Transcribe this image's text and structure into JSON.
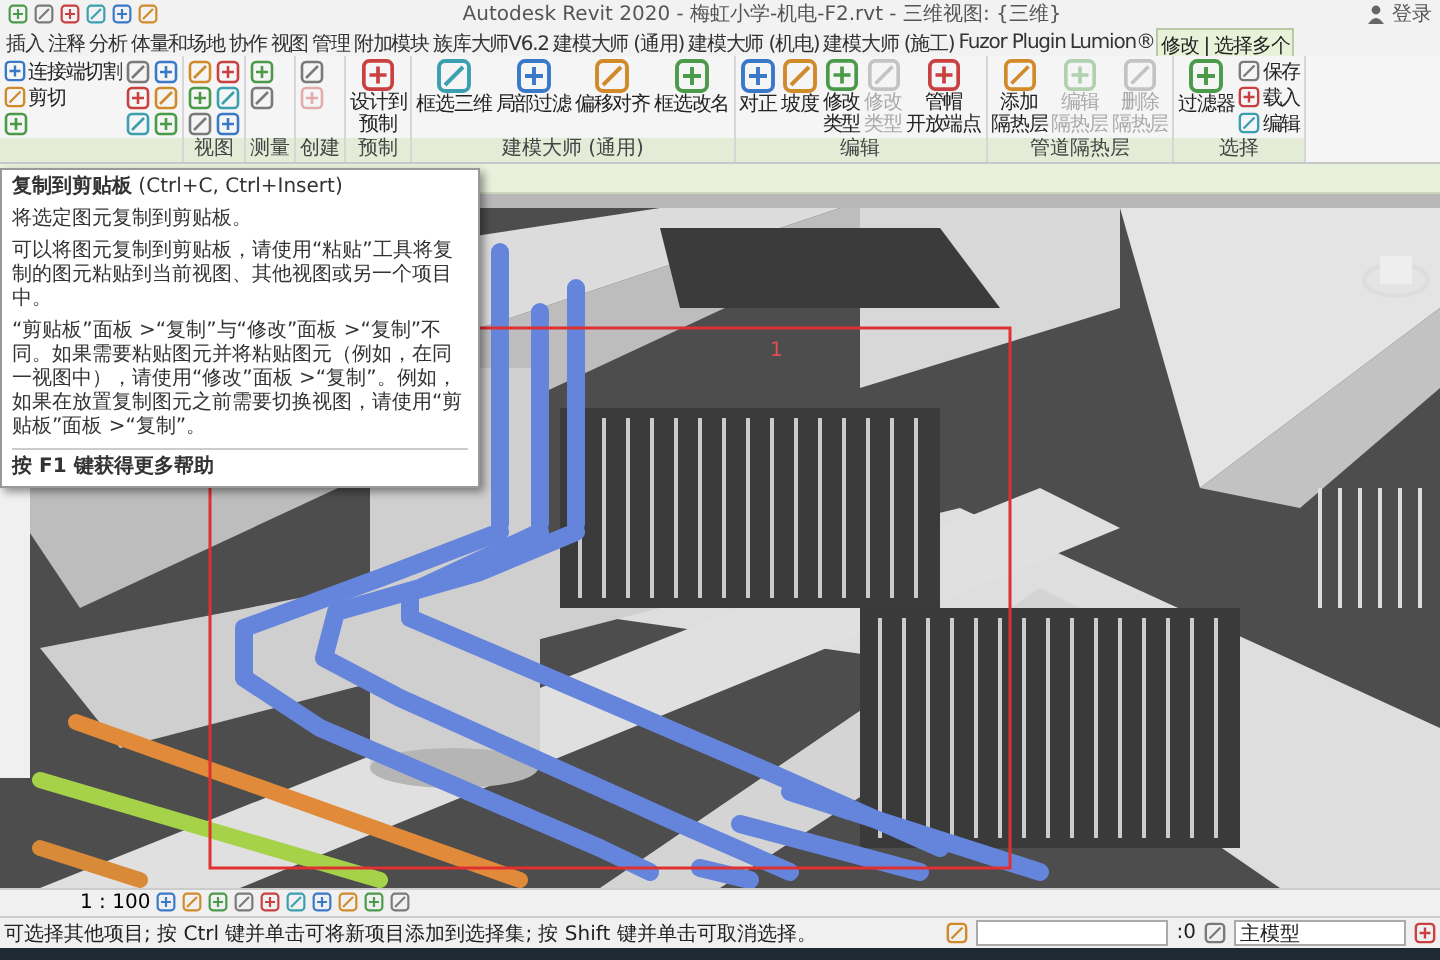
{
  "title_bar": {
    "title": "Autodesk Revit 2020 - 梅虹小学-机电-F2.rvt - 三维视图: {三维}",
    "user": "登录"
  },
  "tabs": [
    {
      "label": "插入",
      "selected": false
    },
    {
      "label": "注释",
      "selected": false
    },
    {
      "label": "分析",
      "selected": false
    },
    {
      "label": "体量和场地",
      "selected": false
    },
    {
      "label": "协作",
      "selected": false
    },
    {
      "label": "视图",
      "selected": false
    },
    {
      "label": "管理",
      "selected": false
    },
    {
      "label": "附加模块",
      "selected": false
    },
    {
      "label": "族库大师V6.2",
      "selected": false
    },
    {
      "label": "建模大师 (通用)",
      "selected": false
    },
    {
      "label": "建模大师 (机电)",
      "selected": false
    },
    {
      "label": "建模大师 (施工)",
      "selected": false
    },
    {
      "label": "Fuzor Plugin",
      "selected": false
    },
    {
      "label": "Lumion®",
      "selected": false
    },
    {
      "label": "修改 | 选择多个",
      "selected": true
    }
  ],
  "ribbon": {
    "panels": [
      {
        "buttons": [
          {
            "kind": "small",
            "label": "连接端切割",
            "disabled": false
          },
          {
            "kind": "small",
            "label": "剪切",
            "disabled": false
          },
          {
            "kind": "icon",
            "disabled": false
          },
          {
            "kind": "icon",
            "disabled": false
          },
          {
            "kind": "icon",
            "disabled": false
          },
          {
            "kind": "icon",
            "disabled": false
          },
          {
            "kind": "icon",
            "disabled": false
          },
          {
            "kind": "icon",
            "disabled": false
          },
          {
            "kind": "icon",
            "disabled": false
          }
        ]
      },
      {
        "label": "视图",
        "buttons": [
          {
            "kind": "icon",
            "disabled": false
          },
          {
            "kind": "icon",
            "disabled": false
          },
          {
            "kind": "icon",
            "disabled": false
          },
          {
            "kind": "icon",
            "disabled": false
          },
          {
            "kind": "icon",
            "disabled": false
          },
          {
            "kind": "icon",
            "disabled": false
          }
        ]
      },
      {
        "label": "测量",
        "buttons": [
          {
            "kind": "icon",
            "disabled": false
          },
          {
            "kind": "icon",
            "disabled": false
          }
        ]
      },
      {
        "label": "创建",
        "buttons": [
          {
            "kind": "icon",
            "disabled": false
          },
          {
            "kind": "icon",
            "disabled": true
          }
        ]
      },
      {
        "label": "预制",
        "buttons": [
          {
            "kind": "large",
            "label": [
              "设计到",
              "预制"
            ],
            "disabled": false
          }
        ]
      },
      {
        "label": "建模大师 (通用)",
        "buttons": [
          {
            "kind": "large",
            "label": "框选三维",
            "disabled": false
          },
          {
            "kind": "large",
            "label": "局部过滤",
            "disabled": false
          },
          {
            "kind": "large",
            "label": "偏移对齐",
            "disabled": false
          },
          {
            "kind": "large",
            "label": "框选改名",
            "disabled": false
          }
        ]
      },
      {
        "label": "编辑",
        "buttons": [
          {
            "kind": "large",
            "label": "对正",
            "disabled": false
          },
          {
            "kind": "large",
            "label": "坡度",
            "disabled": false
          },
          {
            "kind": "large",
            "label": [
              "修改",
              "类型"
            ],
            "disabled": false
          },
          {
            "kind": "large",
            "label": [
              "修改",
              "类型"
            ],
            "disabled": true
          },
          {
            "kind": "large",
            "label": [
              "管帽",
              "开放端点"
            ],
            "disabled": false
          }
        ]
      },
      {
        "label": "管道隔热层",
        "buttons": [
          {
            "kind": "large",
            "label": [
              "添加",
              "隔热层"
            ],
            "disabled": false
          },
          {
            "kind": "large",
            "label": [
              "编辑",
              "隔热层"
            ],
            "disabled": true
          },
          {
            "kind": "large",
            "label": [
              "删除",
              "隔热层"
            ],
            "disabled": true
          }
        ]
      },
      {
        "label": "选择",
        "buttons": [
          {
            "kind": "large",
            "label": "过滤器",
            "disabled": false
          },
          {
            "kind": "small",
            "label": "保存",
            "disabled": false
          },
          {
            "kind": "small",
            "label": "载入",
            "disabled": false
          },
          {
            "kind": "small",
            "label": "编辑",
            "disabled": false
          }
        ]
      }
    ]
  },
  "tooltip": {
    "title": "**复制到剪贴板** (Ctrl+C, Ctrl+Insert)",
    "description": "将选定图元复制到剪贴板。",
    "details": [
      "可以将图元复制到剪贴板，请使用“粘贴”工具将复制的图元粘贴到当前视图、其他视图或另一个项目中。",
      "“剪贴板”面板 >“复制”与“修改”面板 >“复制”不同。如果需要粘贴图元并将粘贴图元（例如，在同一视图中），请使用“修改”面板 >“复制”。例如，如果在放置复制图元之前需要切换视图，请使用“剪贴板”面板 >“复制”。"
    ],
    "help": "按 F1 键获得更多帮助"
  },
  "view": {
    "selection_label": "1"
  },
  "view_bar": {
    "scale": "1 : 100"
  },
  "status_bar": {
    "message": "可选择其他项目; 按 Ctrl 键并单击可将新项目添加到选择集; 按 Shift 键并单击可取消选择。",
    "count": ":0",
    "model": "主模型"
  }
}
